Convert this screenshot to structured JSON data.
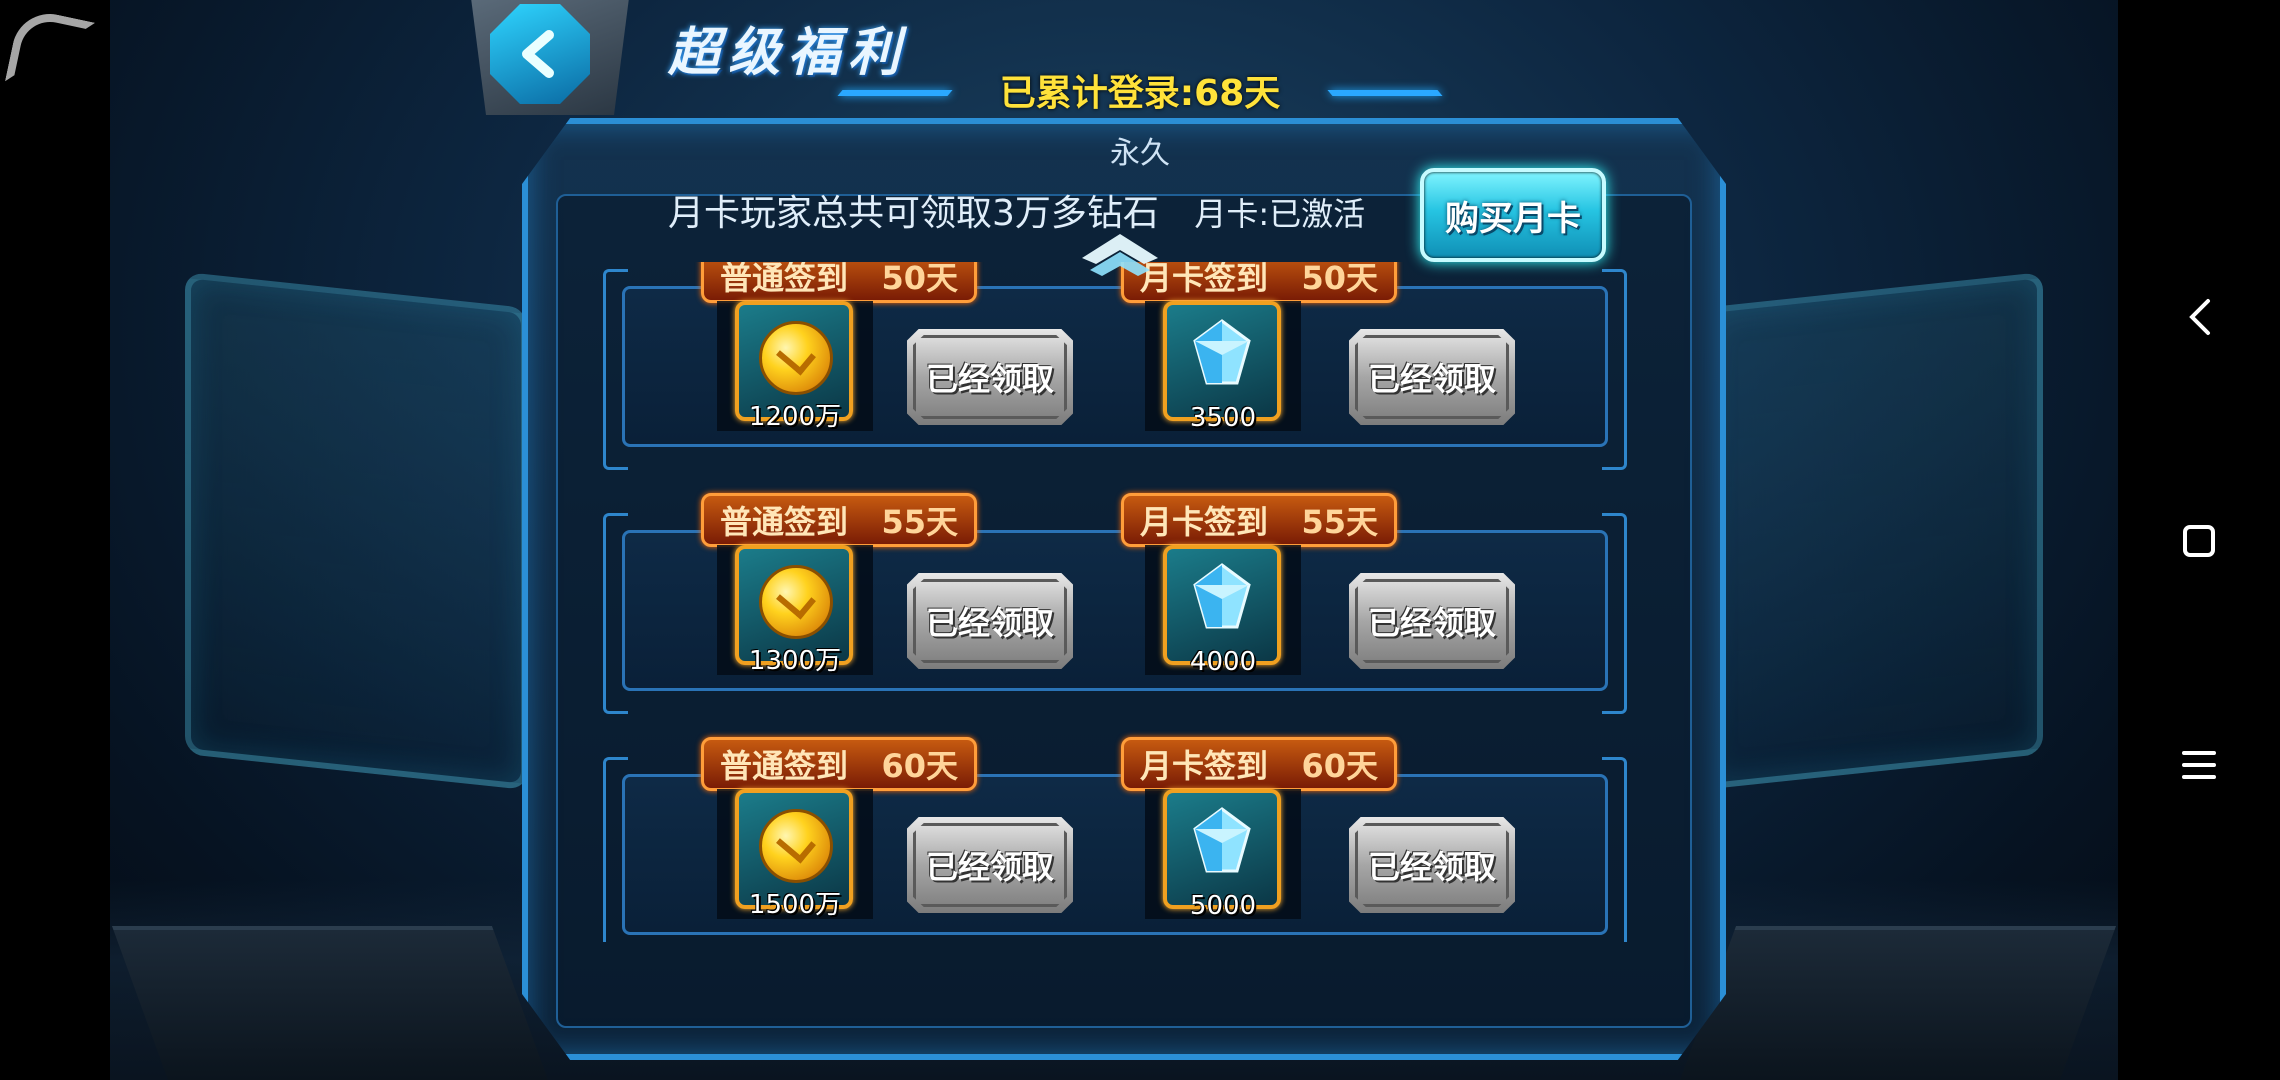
{
  "header": {
    "title": "超级福利",
    "login_label": "已累计登录:68天"
  },
  "panel": {
    "subtitle": "永久",
    "info_text": "月卡玩家总共可领取3万多钻石",
    "card_status": "月卡:已激活",
    "buy_button": "购买月卡"
  },
  "rows": [
    {
      "normal": {
        "tag_label": "普通签到",
        "days": "50天",
        "reward_count": "1200万",
        "status": "已经领取"
      },
      "monthly": {
        "tag_label": "月卡签到",
        "days": "50天",
        "reward_count": "3500",
        "status": "已经领取"
      }
    },
    {
      "normal": {
        "tag_label": "普通签到",
        "days": "55天",
        "reward_count": "1300万",
        "status": "已经领取"
      },
      "monthly": {
        "tag_label": "月卡签到",
        "days": "55天",
        "reward_count": "4000",
        "status": "已经领取"
      }
    },
    {
      "normal": {
        "tag_label": "普通签到",
        "days": "60天",
        "reward_count": "1500万",
        "status": "已经领取"
      },
      "monthly": {
        "tag_label": "月卡签到",
        "days": "60天",
        "reward_count": "5000",
        "status": "已经领取"
      }
    }
  ],
  "icons": {
    "back": "back-arrow-icon",
    "coin": "gold-coin-icon",
    "diamond": "diamond-icon",
    "scroll": "scroll-up-icon",
    "nav_back": "nav-back-icon",
    "nav_home": "nav-home-icon",
    "nav_menu": "nav-menu-icon"
  },
  "colors": {
    "accent": "#2b8fd6",
    "login_text": "#ffe23a",
    "tag_orange": "#c65a10",
    "buy_button": "#26c4e2",
    "claimed_gray": "#a6a6a6"
  }
}
